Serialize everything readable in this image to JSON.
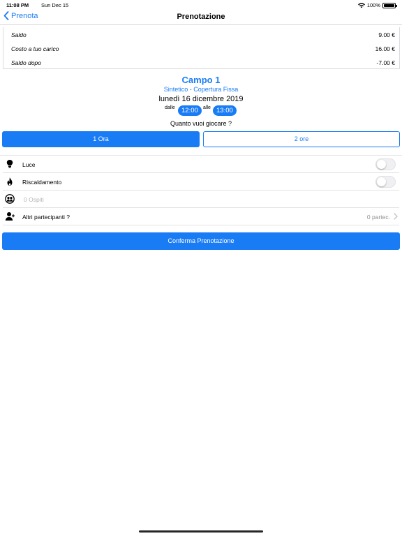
{
  "status_bar": {
    "time": "11:08 PM",
    "date": "Sun Dec 15",
    "battery": "100%"
  },
  "nav": {
    "back_label": "Prenota",
    "title": "Prenotazione"
  },
  "balance": {
    "rows": [
      {
        "label": "Saldo",
        "value": "9.00 €"
      },
      {
        "label": "Costo a tuo carico",
        "value": "16.00 €"
      },
      {
        "label": "Saldo dopo",
        "value": "-7.00 €"
      }
    ]
  },
  "court": {
    "name": "Campo 1",
    "subtitle": "Sintetico - Copertura Fissa",
    "date": "lunedì 16 dicembre 2019",
    "from_label": "dalle",
    "from_time": "12:00",
    "to_label": "alle",
    "to_time": "13:00"
  },
  "duration": {
    "question": "Quanto vuoi giocare ?",
    "options": [
      "1 Ora",
      "2 ore"
    ],
    "selected_index": 0
  },
  "options": {
    "light": {
      "label": "Luce",
      "icon": "lightbulb-icon",
      "on": false
    },
    "heating": {
      "label": "Riscaldamento",
      "icon": "flame-icon",
      "on": false
    },
    "guests": {
      "placeholder": "0 Ospiti",
      "icon": "guests-icon"
    },
    "participants": {
      "label": "Altri partecipanti ?",
      "value": "0 partec.",
      "icon": "person-add-icon"
    }
  },
  "confirm_label": "Conferma Prenotazione",
  "colors": {
    "accent": "#1a7cf5",
    "divider": "#e3e3e6",
    "muted": "#8e8e93"
  }
}
